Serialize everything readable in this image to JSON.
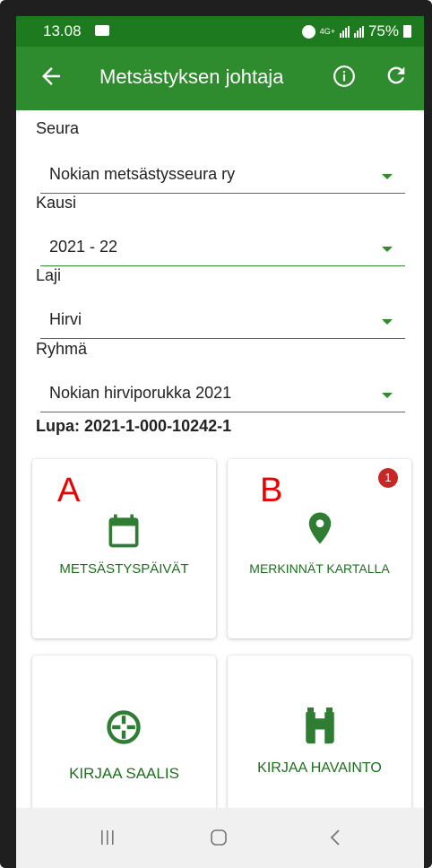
{
  "status_bar": {
    "time": "13.08",
    "network": "4G+",
    "battery": "75%"
  },
  "app_bar": {
    "title": "Metsästyksen johtaja"
  },
  "form": {
    "fields": [
      {
        "label": "Seura",
        "value": "Nokian metsästysseura ry"
      },
      {
        "label": "Kausi",
        "value": "2021 - 22"
      },
      {
        "label": "Laji",
        "value": "Hirvi"
      },
      {
        "label": "Ryhmä",
        "value": "Nokian hirviporukka 2021"
      }
    ],
    "permit": "Lupa: 2021-1-000-10242-1"
  },
  "tiles": [
    {
      "letter": "A",
      "label": "METSÄSTYSPÄIVÄT",
      "icon": "calendar-icon"
    },
    {
      "letter": "B",
      "label": "MERKINNÄT KARTALLA",
      "icon": "location-pin-icon",
      "badge": "1"
    },
    {
      "label": "KIRJAA SAALIS",
      "icon": "crosshair-icon"
    },
    {
      "label": "KIRJAA HAVAINTO",
      "icon": "binoculars-icon"
    }
  ],
  "colors": {
    "primary": "#2e8b2e",
    "status_bar": "#1e7a1e",
    "annotation": "#ee0000",
    "badge": "#c62828"
  }
}
